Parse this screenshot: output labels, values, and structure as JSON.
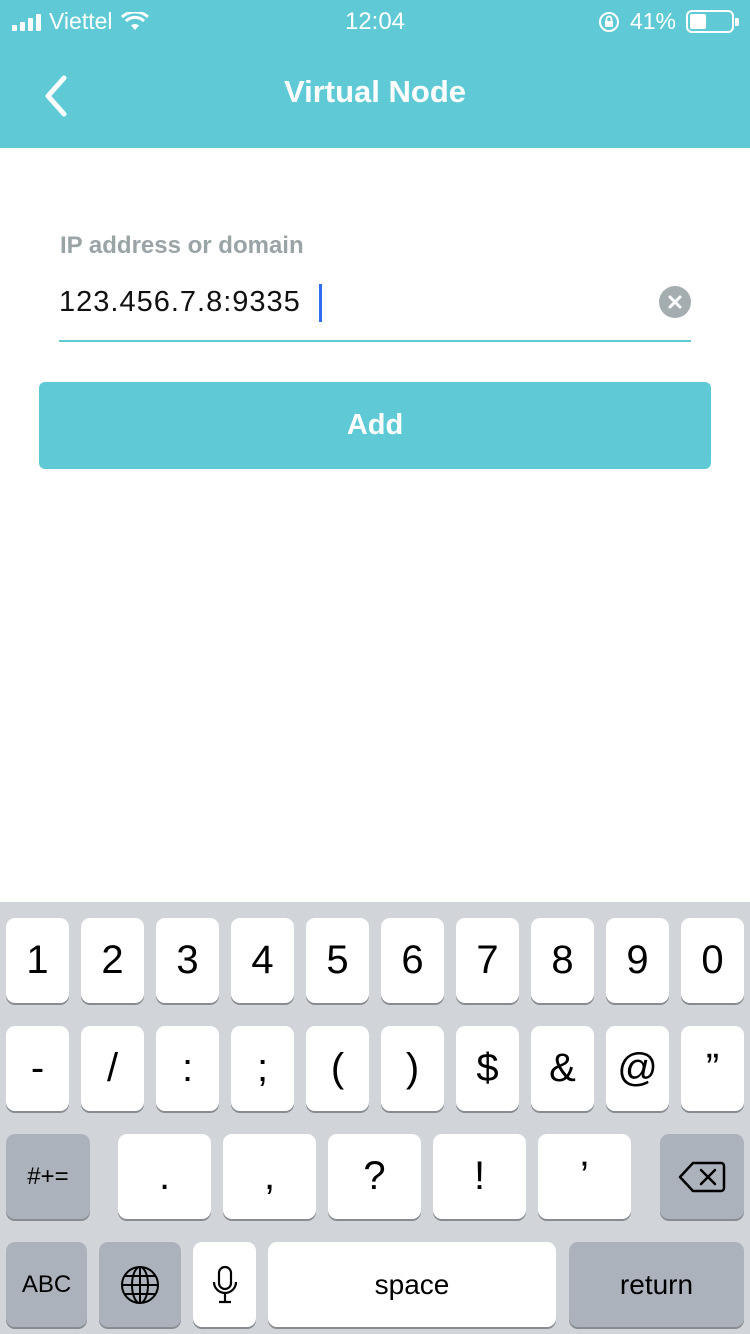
{
  "status": {
    "carrier": "Viettel",
    "time": "12:04",
    "battery": "41%"
  },
  "header": {
    "title": "Virtual Node"
  },
  "form": {
    "label": "IP address or domain",
    "value": "123.456.7.8:9335",
    "add_label": "Add"
  },
  "keyboard": {
    "row1": [
      "1",
      "2",
      "3",
      "4",
      "5",
      "6",
      "7",
      "8",
      "9",
      "0"
    ],
    "row2": [
      "-",
      "/",
      ":",
      ";",
      "(",
      ")",
      "$",
      "&",
      "@",
      "”"
    ],
    "row3": [
      ".",
      ",",
      "?",
      "!",
      "’"
    ],
    "symbols_label": "#+=",
    "abc_label": "ABC",
    "space_label": "space",
    "return_label": "return"
  },
  "colors": {
    "accent": "#5fcad5",
    "caret": "#2f6cf0",
    "keyboard_bg": "#d1d4d9"
  }
}
